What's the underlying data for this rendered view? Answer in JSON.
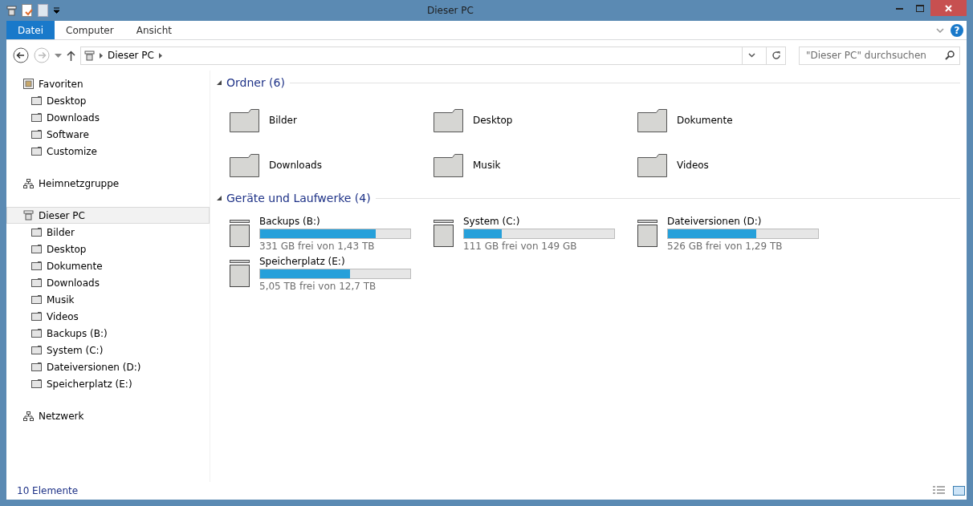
{
  "window": {
    "title": "Dieser PC"
  },
  "ribbon_tabs": [
    {
      "label": "Datei",
      "selected": true
    },
    {
      "label": "Computer",
      "selected": false
    },
    {
      "label": "Ansicht",
      "selected": false
    }
  ],
  "address": {
    "crumbs": [
      "Dieser PC"
    ]
  },
  "search": {
    "placeholder": "\"Dieser PC\" durchsuchen"
  },
  "nav": [
    {
      "label": "Favoriten",
      "kind": "star",
      "selected": false,
      "children": [
        {
          "label": "Desktop",
          "selected": false
        },
        {
          "label": "Downloads",
          "selected": false
        },
        {
          "label": "Software",
          "selected": false
        },
        {
          "label": "Customize",
          "selected": false
        }
      ]
    },
    {
      "label": "Heimnetzgruppe",
      "kind": "network",
      "selected": false
    },
    {
      "label": "Dieser PC",
      "kind": "pc",
      "selected": true,
      "children": [
        {
          "label": "Bilder",
          "selected": false
        },
        {
          "label": "Desktop",
          "selected": false
        },
        {
          "label": "Dokumente",
          "selected": false
        },
        {
          "label": "Downloads",
          "selected": false
        },
        {
          "label": "Musik",
          "selected": false
        },
        {
          "label": "Videos",
          "selected": false
        },
        {
          "label": "Backups (B:)",
          "selected": false
        },
        {
          "label": "System (C:)",
          "selected": false
        },
        {
          "label": "Dateiversionen (D:)",
          "selected": false
        },
        {
          "label": "Speicherplatz (E:)",
          "selected": false
        }
      ]
    },
    {
      "label": "Netzwerk",
      "kind": "network",
      "selected": false
    }
  ],
  "sections": [
    {
      "title": "Ordner (6)",
      "kind": "folders",
      "items": [
        {
          "name": "Bilder"
        },
        {
          "name": "Desktop"
        },
        {
          "name": "Dokumente"
        },
        {
          "name": "Downloads"
        },
        {
          "name": "Musik"
        },
        {
          "name": "Videos"
        }
      ]
    },
    {
      "title": "Geräte und Laufwerke (4)",
      "kind": "drives",
      "items": [
        {
          "name": "Backups (B:)",
          "level": 0.77,
          "reading": "331 GB frei von 1,43 TB"
        },
        {
          "name": "System (C:)",
          "level": 0.25,
          "reading": "111 GB frei von 149 GB"
        },
        {
          "name": "Dateiversionen (D:)",
          "level": 0.59,
          "reading": "526 GB frei von 1,29 TB"
        },
        {
          "name": "Speicherplatz (E:)",
          "level": 0.6,
          "reading": "5,05 TB frei von 12,7 TB"
        }
      ]
    }
  ],
  "help": {
    "label": "?"
  },
  "status_bar": {
    "text": "10 Elemente"
  }
}
